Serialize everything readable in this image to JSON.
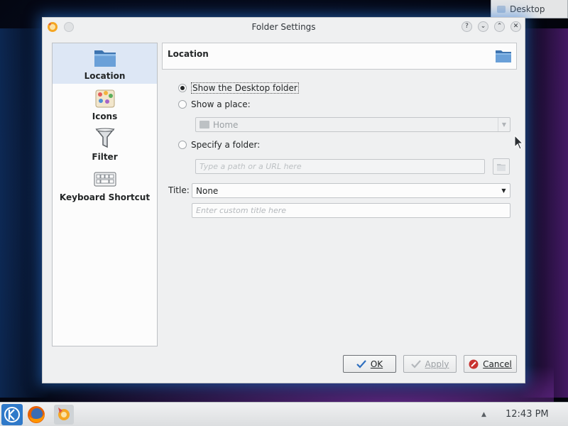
{
  "desktop_tab": {
    "label": "Desktop"
  },
  "dialog": {
    "title": "Folder Settings",
    "titlebar_buttons": [
      "?",
      "⌄",
      "⌃",
      "✕"
    ]
  },
  "sidebar": {
    "items": [
      {
        "label": "Location",
        "selected": true,
        "icon": "folder-icon"
      },
      {
        "label": "Icons",
        "selected": false,
        "icon": "icons-palette-icon"
      },
      {
        "label": "Filter",
        "selected": false,
        "icon": "funnel-icon"
      },
      {
        "label": "Keyboard Shortcut",
        "selected": false,
        "icon": "keyboard-icon"
      }
    ]
  },
  "page": {
    "header_title": "Location",
    "options": {
      "desktop_folder": {
        "label": "Show the Desktop folder",
        "checked": true
      },
      "place": {
        "label": "Show a place:",
        "checked": false,
        "combo_value": "Home"
      },
      "specify_folder": {
        "label": "Specify a folder:",
        "checked": false,
        "placeholder": "Type a path or a URL here"
      }
    },
    "title_field": {
      "label": "Title:",
      "value": "None",
      "custom_placeholder": "Enter custom title here"
    }
  },
  "buttons": {
    "ok": "OK",
    "apply": "Apply",
    "cancel": "Cancel"
  },
  "taskbar": {
    "clock": "12:43 PM",
    "tray_arrow": "▲"
  },
  "colors": {
    "selection": "#dde7f5",
    "folder_blue": "#5b8ec7",
    "glow": "#2878dc"
  }
}
